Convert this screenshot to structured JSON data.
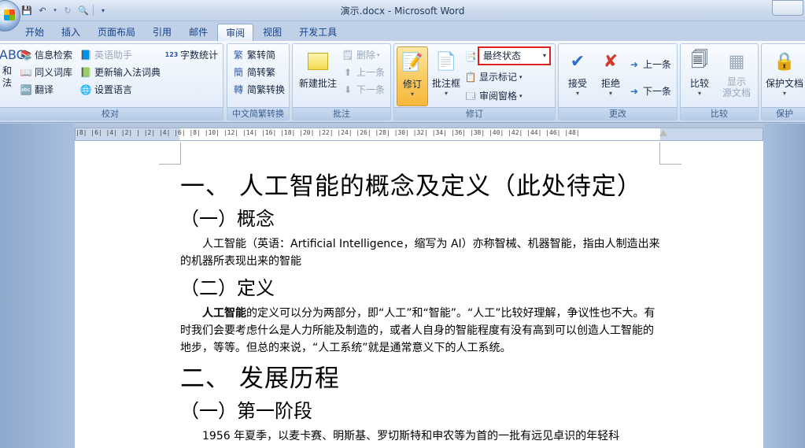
{
  "window": {
    "title": "演示.docx - Microsoft Word"
  },
  "tabs": [
    "开始",
    "插入",
    "页面布局",
    "引用",
    "邮件",
    "审阅",
    "视图",
    "开发工具"
  ],
  "active_tab": "审阅",
  "ribbon": {
    "proofing": {
      "label": "校对",
      "partial_big": "和\n法",
      "research": "信息检索",
      "thesaurus": "同义词库",
      "translate": "翻译",
      "english_assistant": "英语助手",
      "update_ime": "更新输入法词典",
      "set_language": "设置语言",
      "word_count": "字数统计"
    },
    "chinese": {
      "label": "中文简繁转换",
      "to_simplified": "繁转简",
      "to_traditional": "简转繁",
      "convert": "简繁转换"
    },
    "comments": {
      "label": "批注",
      "new_comment": "新建批注",
      "delete": "删除",
      "previous": "上一条",
      "next": "下一条"
    },
    "tracking": {
      "label": "修订",
      "track_changes": "修订",
      "balloons": "批注框",
      "display_for_review": "最终状态",
      "show_markup": "显示标记",
      "reviewing_pane": "审阅窗格"
    },
    "changes": {
      "label": "更改",
      "accept": "接受",
      "reject": "拒绝",
      "previous": "上一条",
      "next": "下一条"
    },
    "compare": {
      "label": "比较",
      "compare": "比较",
      "show_source": "显示\n源文档"
    },
    "protect": {
      "label": "保护",
      "protect_doc": "保护文档"
    }
  },
  "ruler": {
    "text": "|8| |6| |4| |2| | |2| |4| |6| |8| |10| |12| |14| |16| |18| |20| |22| |24| |26| |28| |30| |32| |34| |36| |38| |40| |42| |44| |46| |48|"
  },
  "document": {
    "h1_1": "一、  人工智能的概念及定义（此处待定）",
    "h2_1": "（一）概念",
    "p1": "人工智能（英语：Artificial Intelligence，缩写为 AI）亦称智械、机器智能，指由人制造出来的机器所表现出来的智能",
    "h2_2": "（二）定义",
    "p2_bold": "人工智能",
    "p2_rest": "的定义可以分为两部分，即“人工”和“智能”。“人工”比较好理解，争议性也不大。有时我们会要考虑什么是人力所能及制造的，或者人自身的智能程度有没有高到可以创造人工智能的地步，等等。但总的来说，“人工系统”就是通常意义下的人工系统。",
    "h1_2": "二、  发展历程",
    "h2_3": "（一）第一阶段",
    "p3": "1956 年夏季，以麦卡赛、明斯基、罗切斯特和申农等为首的一批有远见卓识的年轻科"
  }
}
